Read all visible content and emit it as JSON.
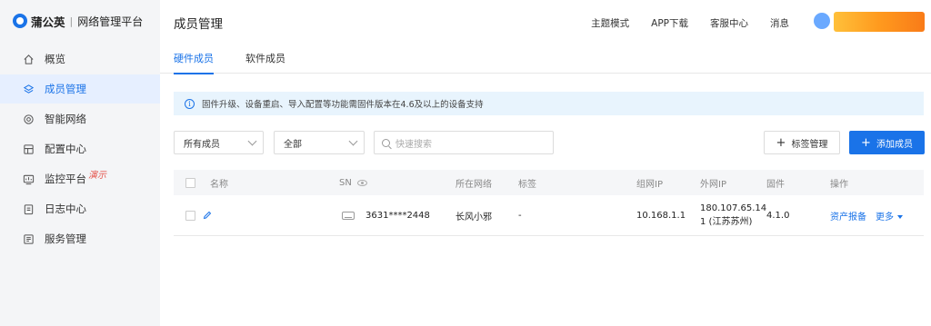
{
  "sidebar": {
    "brand": "蒲公英",
    "subtitle": "网络管理平台",
    "items": [
      {
        "label": "概览",
        "icon": "home-icon"
      },
      {
        "label": "成员管理",
        "icon": "layers-icon",
        "active": true
      },
      {
        "label": "智能网络",
        "icon": "network-icon"
      },
      {
        "label": "配置中心",
        "icon": "config-icon"
      },
      {
        "label": "监控平台",
        "icon": "monitor-icon",
        "badge": "演示"
      },
      {
        "label": "日志中心",
        "icon": "log-icon"
      },
      {
        "label": "服务管理",
        "icon": "service-icon"
      }
    ]
  },
  "header": {
    "title": "成员管理",
    "links": [
      "主题模式",
      "APP下载",
      "客服中心",
      "消息"
    ]
  },
  "tabs": [
    "硬件成员",
    "软件成员"
  ],
  "notice": "固件升级、设备重启、导入配置等功能需固件版本在4.6及以上的设备支持",
  "filters": {
    "member_select": "所有成员",
    "network_select": "全部",
    "search_placeholder": "快速搜索"
  },
  "buttons": {
    "tag_manage": "标签管理",
    "add_member": "添加成员"
  },
  "table": {
    "columns": [
      "名称",
      "SN",
      "所在网络",
      "标签",
      "组网IP",
      "外网IP",
      "固件",
      "操作"
    ],
    "rows": [
      {
        "name": "",
        "sn": "3631****2448",
        "network": "长风小邪",
        "tag": "-",
        "lan_ip": "10.168.1.1",
        "wan_ip_line1": "180.107.65.14",
        "wan_ip_line2": "1 (江苏苏州)",
        "firmware": "4.1.0",
        "action_report": "资产报备",
        "action_more": "更多"
      }
    ]
  },
  "colors": {
    "accent": "#1a73e8",
    "sidebar_bg": "#f4f5f7",
    "notice_bg": "#e8f4fd"
  }
}
